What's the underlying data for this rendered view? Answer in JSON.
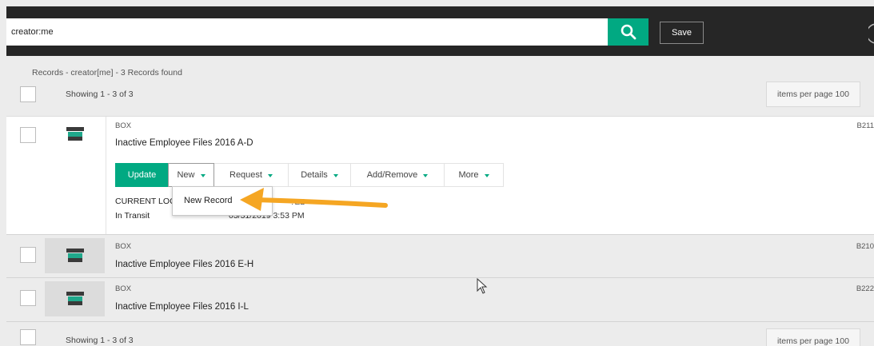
{
  "search": {
    "value": "creator:me",
    "save_label": "Save"
  },
  "results": {
    "heading": "Records - creator[me] - 3 Records found",
    "showing": "Showing 1 - 3 of 3",
    "items_per_page": "items per page 100"
  },
  "records": [
    {
      "type": "BOX",
      "title": "Inactive Employee Files 2016 A-D",
      "number": "B211",
      "icon": "box-icon",
      "actions": [
        "Update",
        "New",
        "Request",
        "Details",
        "Add/Remove",
        "More"
      ],
      "location_label": "CURRENT LOC",
      "location_value": "In Transit",
      "location_fragment": "?ED",
      "date_fragment": "03/31/2019 3:53 PM"
    },
    {
      "type": "BOX",
      "title": "Inactive Employee Files 2016 E-H",
      "number": "B210",
      "icon": "box-icon"
    },
    {
      "type": "BOX",
      "title": "Inactive Employee Files 2016 I-L",
      "number": "B222",
      "icon": "box-icon"
    }
  ],
  "dropdown": {
    "items": [
      "New Record"
    ]
  },
  "colors": {
    "accent": "#01a982",
    "arrow": "#f5a623",
    "topbar": "#262626"
  }
}
